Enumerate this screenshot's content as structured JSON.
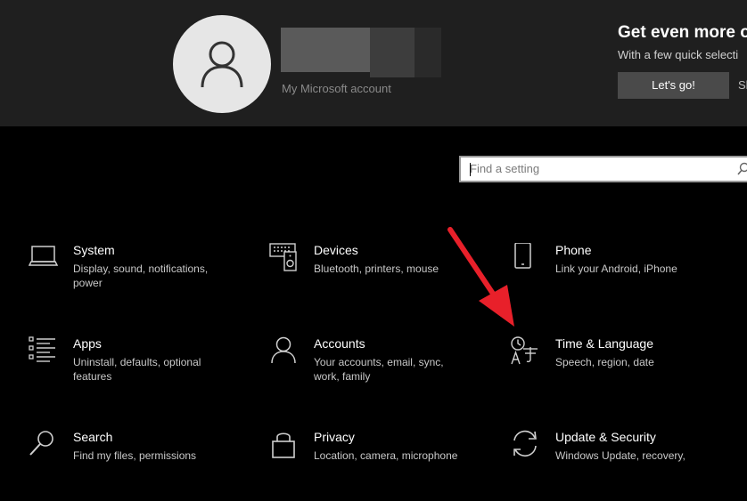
{
  "header": {
    "account_label": "My Microsoft account",
    "promo_title": "Get even more o",
    "promo_subtitle": "With a few quick selecti",
    "promo_button": "Let's go!",
    "promo_skip": "Sk"
  },
  "search": {
    "placeholder": "Find a setting"
  },
  "tiles": [
    {
      "title": "System",
      "desc": "Display, sound, notifications, power",
      "icon": "laptop-icon"
    },
    {
      "title": "Devices",
      "desc": "Bluetooth, printers, mouse",
      "icon": "keyboard-speaker-icon"
    },
    {
      "title": "Phone",
      "desc": "Link your Android, iPhone",
      "icon": "phone-icon"
    },
    {
      "title": "Apps",
      "desc": "Uninstall, defaults, optional features",
      "icon": "apps-list-icon"
    },
    {
      "title": "Accounts",
      "desc": "Your accounts, email, sync, work, family",
      "icon": "person-icon"
    },
    {
      "title": "Time & Language",
      "desc": "Speech, region, date",
      "icon": "time-language-icon"
    },
    {
      "title": "Search",
      "desc": "Find my files, permissions",
      "icon": "search-icon"
    },
    {
      "title": "Privacy",
      "desc": "Location, camera, microphone",
      "icon": "lock-icon"
    },
    {
      "title": "Update & Security",
      "desc": "Windows Update, recovery,",
      "icon": "refresh-icon"
    }
  ],
  "colors": {
    "header_bg": "#1f1f1f",
    "background": "#000000",
    "arrow": "#e8202a"
  }
}
